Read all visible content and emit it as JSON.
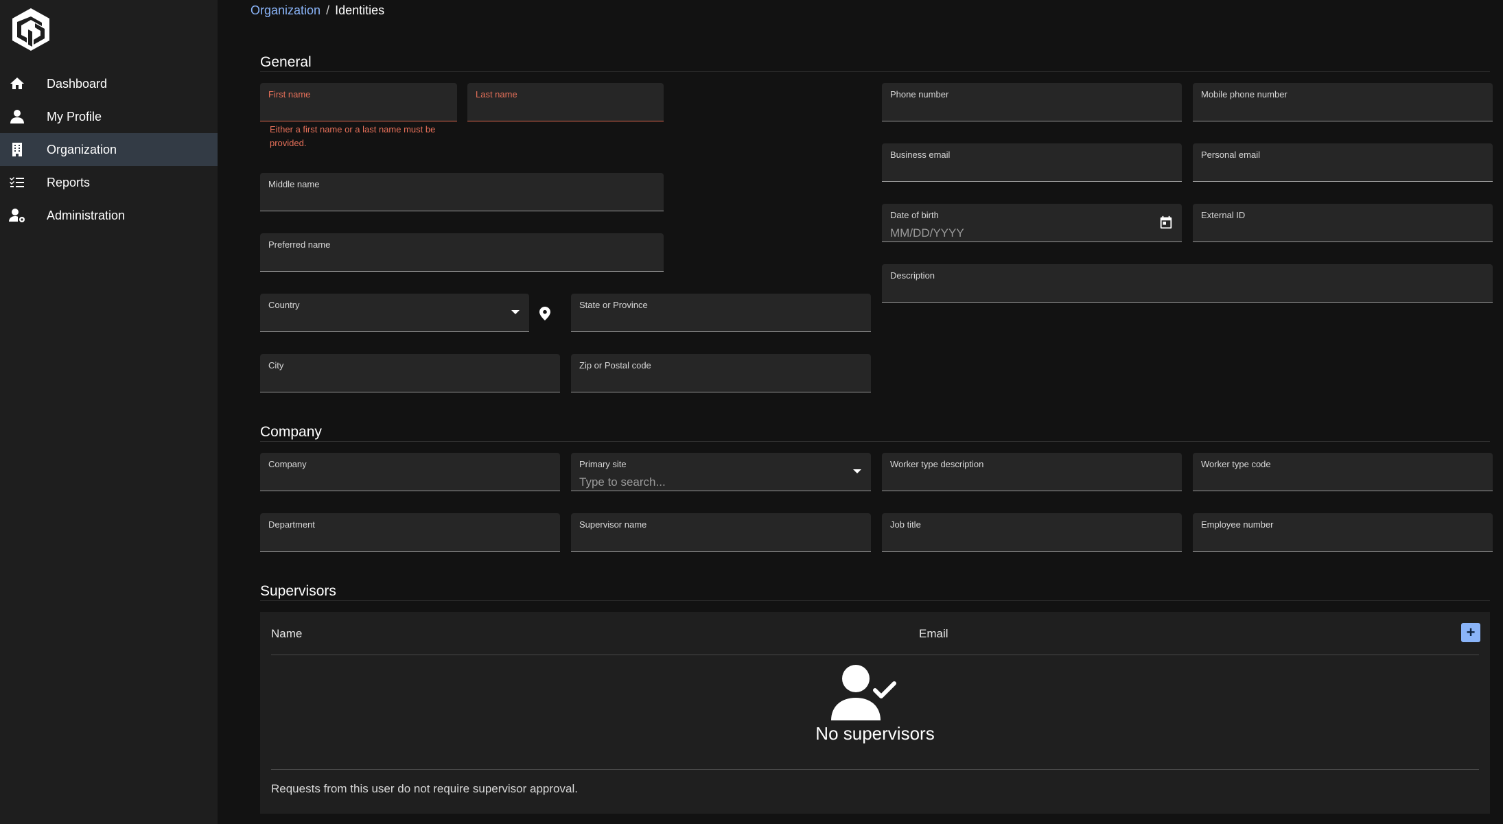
{
  "sidebar": {
    "items": [
      {
        "label": "Dashboard",
        "icon": "home-icon",
        "active": false
      },
      {
        "label": "My Profile",
        "icon": "person-icon",
        "active": false
      },
      {
        "label": "Organization",
        "icon": "building-icon",
        "active": true
      },
      {
        "label": "Reports",
        "icon": "checklist-icon",
        "active": false
      },
      {
        "label": "Administration",
        "icon": "user-gear-icon",
        "active": false
      }
    ]
  },
  "breadcrumb": {
    "parent": "Organization",
    "separator": "/",
    "current": "Identities"
  },
  "general": {
    "title": "General",
    "first_name_label": "First name",
    "last_name_label": "Last name",
    "name_error": "Either a first name or a last name must be provided.",
    "middle_name_label": "Middle name",
    "preferred_name_label": "Preferred name",
    "country_label": "Country",
    "state_label": "State or Province",
    "city_label": "City",
    "zip_label": "Zip or Postal code",
    "phone_label": "Phone number",
    "mobile_label": "Mobile phone number",
    "business_email_label": "Business email",
    "personal_email_label": "Personal email",
    "dob_label": "Date of birth",
    "dob_placeholder": "MM/DD/YYYY",
    "external_id_label": "External ID",
    "description_label": "Description"
  },
  "company": {
    "title": "Company",
    "company_label": "Company",
    "primary_site_label": "Primary site",
    "primary_site_placeholder": "Type to search...",
    "worker_type_desc_label": "Worker type description",
    "worker_type_code_label": "Worker type code",
    "department_label": "Department",
    "supervisor_name_label": "Supervisor name",
    "job_title_label": "Job title",
    "employee_number_label": "Employee number"
  },
  "supervisors": {
    "title": "Supervisors",
    "columns": [
      "Name",
      "Email"
    ],
    "add_label": "+",
    "empty_text": "No supervisors",
    "note": "Requests from this user do not require supervisor approval."
  },
  "colors": {
    "accent": "#8ab4f8",
    "error": "#e8715a",
    "active_nav": "#333b45"
  }
}
